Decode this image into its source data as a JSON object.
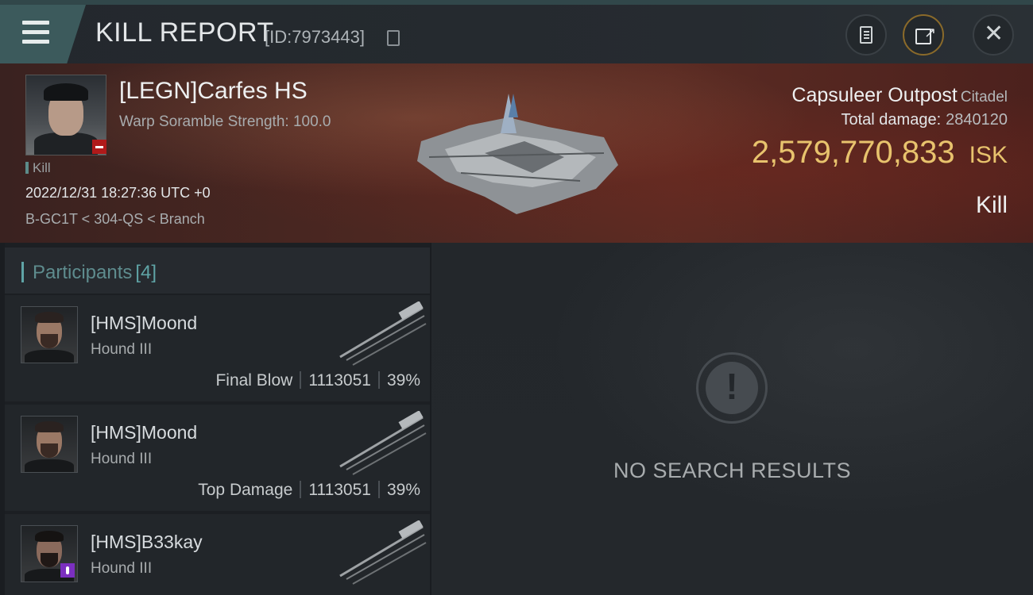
{
  "header": {
    "title": "KILL REPORT",
    "report_id": "[ID:7973443]",
    "icons": [
      "menu-icon",
      "copy-icon",
      "clipboard-icon",
      "share-icon",
      "close-icon"
    ]
  },
  "victim": {
    "name": "[LEGN]Carfes HS",
    "warp_scramble": "Warp Soramble Strength: 100.0",
    "kill_tag": "Kill",
    "timestamp": "2022/12/31 18:27:36 UTC +0",
    "location": "B-GC1T < 304-QS < Branch"
  },
  "target": {
    "type": "Capsuleer Outpost",
    "class": "Citadel",
    "total_damage_label": "Total damage:",
    "total_damage_value": "2840120",
    "isk_amount": "2,579,770,833",
    "isk_unit": "ISK",
    "result": "Kill"
  },
  "participants": {
    "label": "Participants",
    "count": "[4]",
    "items": [
      {
        "name": "[HMS]Moond",
        "ship": "Hound III",
        "role": "Final Blow",
        "damage": "1113051",
        "percent": "39%"
      },
      {
        "name": "[HMS]Moond",
        "ship": "Hound III",
        "role": "Top Damage",
        "damage": "1113051",
        "percent": "39%"
      },
      {
        "name": "[HMS]B33kay",
        "ship": "Hound III"
      }
    ]
  },
  "search": {
    "empty_message": "NO SEARCH RESULTS"
  },
  "colors": {
    "accent_teal": "#5fa4a6",
    "isk_gold": "#e8c36d",
    "badge_red": "#b01a1a",
    "badge_purple": "#7b2fbf"
  }
}
